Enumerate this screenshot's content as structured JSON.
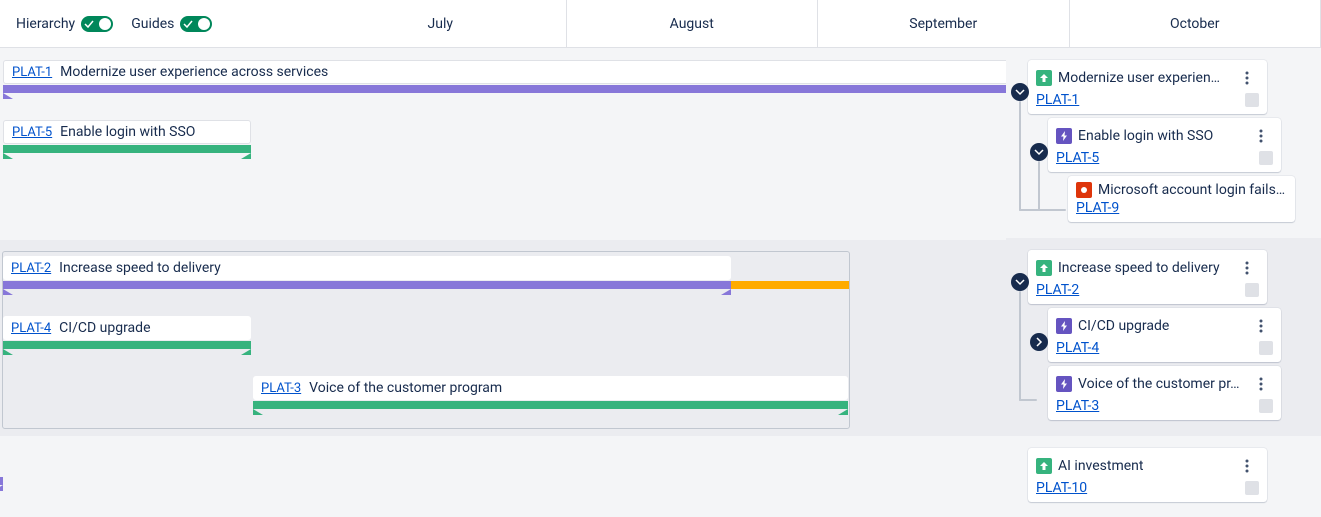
{
  "toolbar": {
    "hierarchy_label": "Hierarchy",
    "guides_label": "Guides"
  },
  "months": [
    "July",
    "August",
    "September",
    "October"
  ],
  "items": {
    "plat1": {
      "key": "PLAT-1",
      "title": "Modernize user experien…",
      "bar_title": "Modernize user experience across services"
    },
    "plat5": {
      "key": "PLAT-5",
      "title": "Enable login with SSO",
      "bar_title": "Enable login with SSO"
    },
    "plat9": {
      "key": "PLAT-9",
      "title": "Microsoft account login fails…"
    },
    "plat2": {
      "key": "PLAT-2",
      "title": "Increase speed to delivery",
      "bar_title": "Increase speed to delivery"
    },
    "plat4": {
      "key": "PLAT-4",
      "title": "CI/CD upgrade",
      "bar_title": "CI/CD upgrade"
    },
    "plat3": {
      "key": "PLAT-3",
      "title": "Voice of the customer pr…",
      "bar_title": "Voice of the customer program"
    },
    "plat10": {
      "key": "PLAT-10",
      "title": "AI investment"
    }
  },
  "icon_names": {
    "arrow_up": "arrow-up-icon",
    "bolt": "bolt-icon",
    "bug": "bug-icon",
    "kebab": "kebab-icon",
    "chevron_down": "chevron-down-icon",
    "chevron_right": "chevron-right-icon",
    "check": "check-icon"
  },
  "colors": {
    "purple": "#8777D9",
    "green": "#36B37E",
    "orange": "#FFAB00",
    "link": "#0052CC"
  }
}
